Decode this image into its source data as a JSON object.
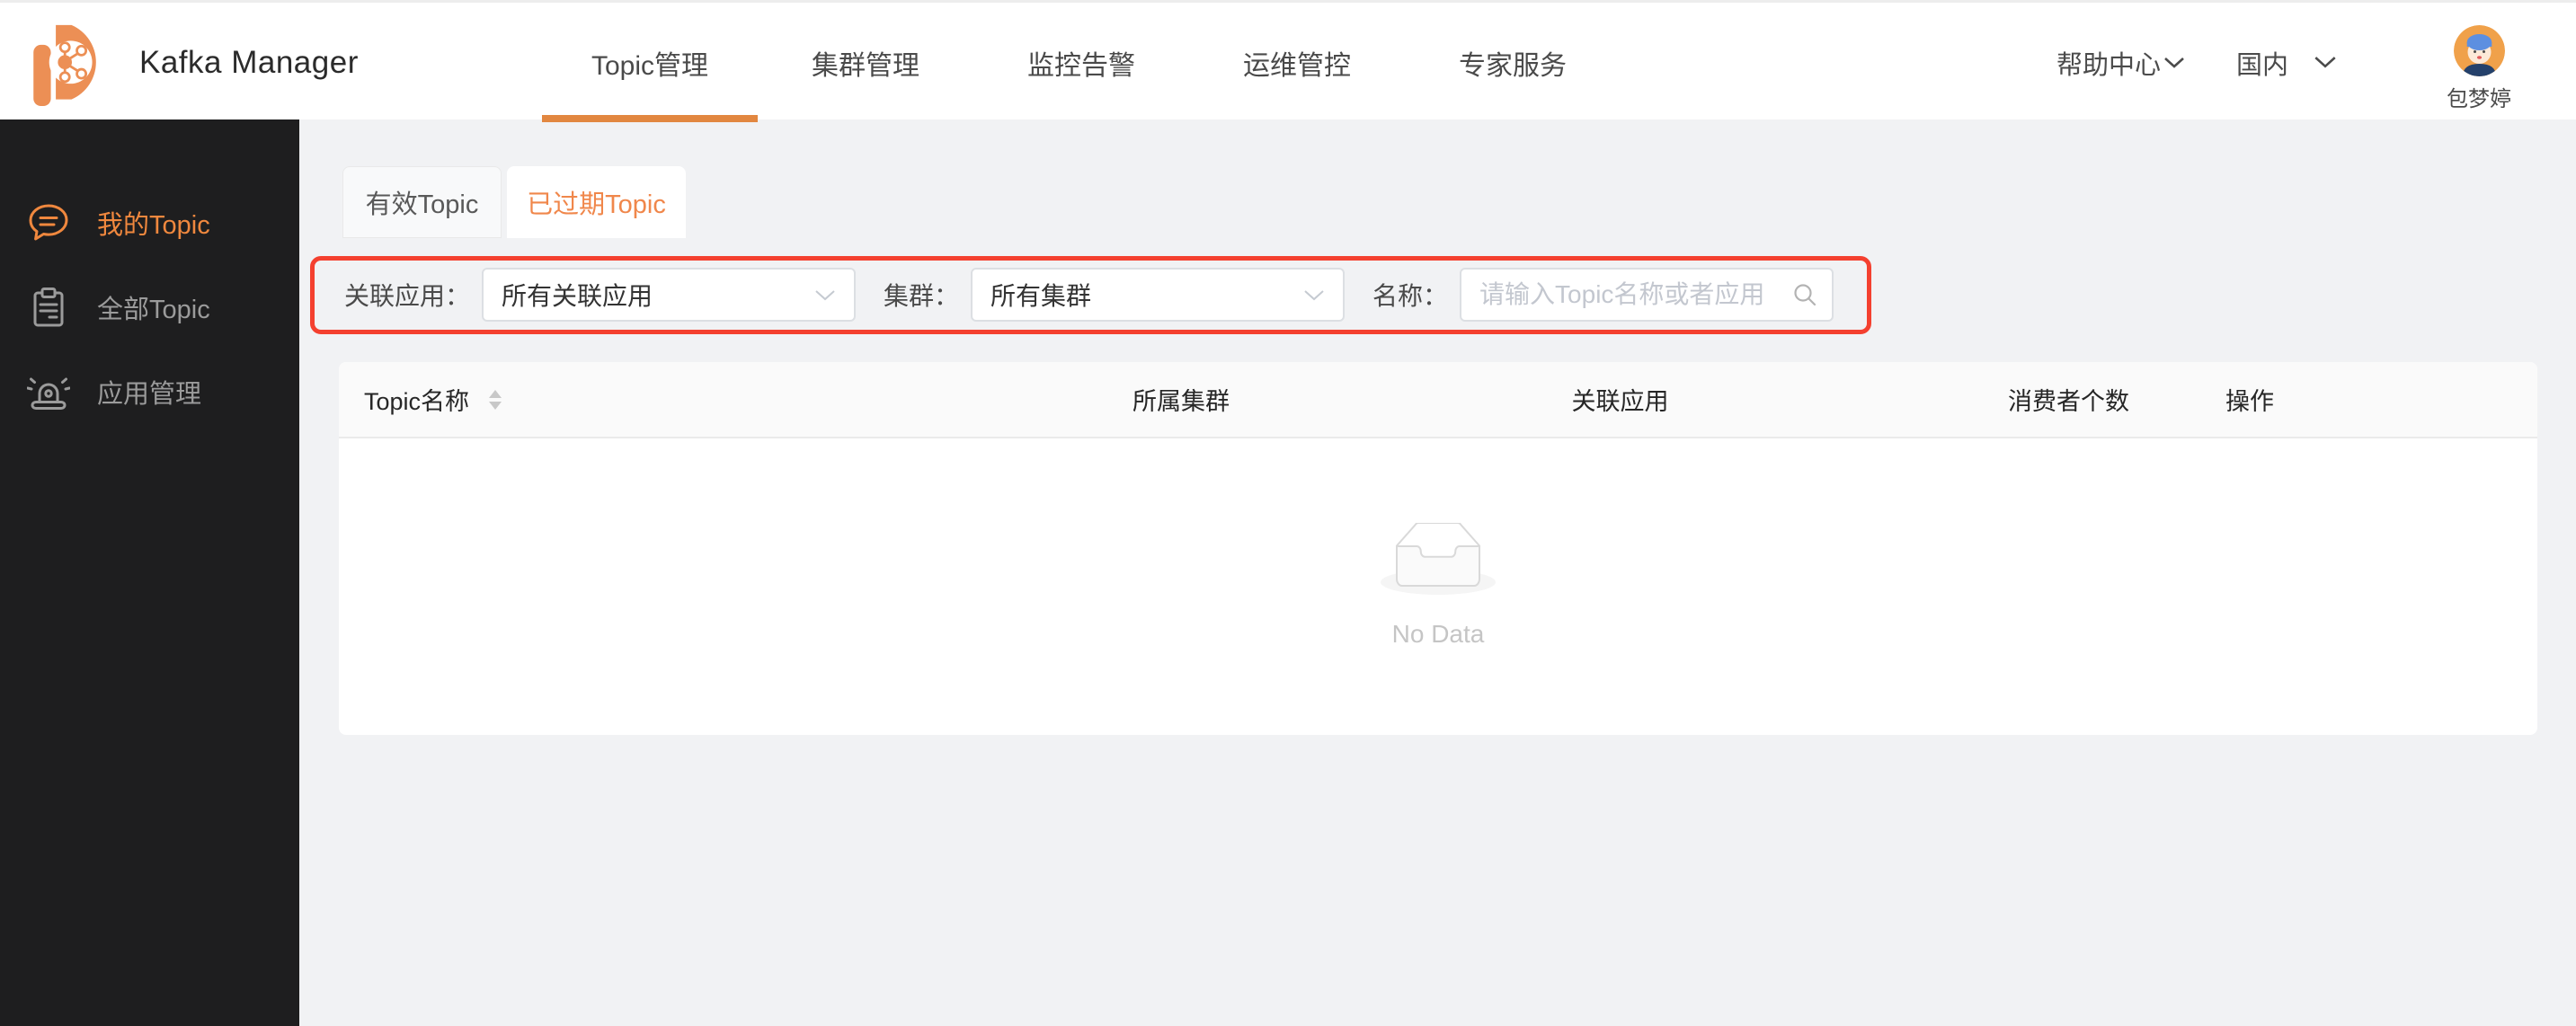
{
  "header": {
    "brand": "Kafka Manager",
    "nav": [
      {
        "label": "Topic管理",
        "active": true
      },
      {
        "label": "集群管理",
        "active": false
      },
      {
        "label": "监控告警",
        "active": false
      },
      {
        "label": "运维管控",
        "active": false
      },
      {
        "label": "专家服务",
        "active": false
      }
    ],
    "help_label": "帮助中心",
    "region_label": "国内",
    "user_name": "包梦婷"
  },
  "sidebar": {
    "items": [
      {
        "label": "我的Topic",
        "icon": "chat-bubble-icon",
        "active": true
      },
      {
        "label": "全部Topic",
        "icon": "clipboard-icon",
        "active": false
      },
      {
        "label": "应用管理",
        "icon": "alarm-icon",
        "active": false
      }
    ]
  },
  "main": {
    "tabs": [
      {
        "label": "有效Topic",
        "active": false
      },
      {
        "label": "已过期Topic",
        "active": true
      }
    ],
    "filters": {
      "app_label": "关联应用：",
      "app_value": "所有关联应用",
      "cluster_label": "集群：",
      "cluster_value": "所有集群",
      "name_label": "名称：",
      "name_placeholder": "请输入Topic名称或者应用"
    },
    "table": {
      "columns": [
        "Topic名称",
        "所属集群",
        "关联应用",
        "消费者个数",
        "操作"
      ],
      "rows": [],
      "empty_text": "No Data"
    }
  },
  "colors": {
    "accent_orange": "#EE8845",
    "nav_underline": "#E28740",
    "annotation_red": "#F4402F",
    "sidebar_bg": "#1E1E1F",
    "page_bg": "#F1F2F4"
  }
}
